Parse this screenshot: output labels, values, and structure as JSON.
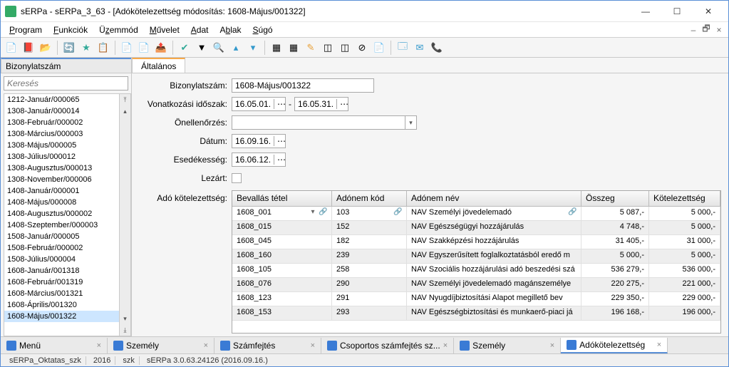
{
  "window": {
    "title": "sERPa - sERPa_3_63 - [Adókötelezettség módosítás: 1608-Május/001322]"
  },
  "menu": {
    "items": [
      "Program",
      "Funkciók",
      "Üzemmód",
      "Művelet",
      "Adat",
      "Ablak",
      "Súgó"
    ]
  },
  "leftPanel": {
    "title": "Bizonylatszám",
    "searchPlaceholder": "Keresés",
    "items": [
      "1212-Január/000065",
      "1308-Január/000014",
      "1308-Február/000002",
      "1308-Március/000003",
      "1308-Május/000005",
      "1308-Július/000012",
      "1308-Augusztus/000013",
      "1308-November/000006",
      "1408-Január/000001",
      "1408-Május/000008",
      "1408-Augusztus/000002",
      "1408-Szeptember/000003",
      "1508-Január/000005",
      "1508-Február/000002",
      "1508-Július/000004",
      "1608-Január/001318",
      "1608-Február/001319",
      "1608-Március/001321",
      "1608-Április/001320",
      "1608-Május/001322"
    ],
    "selectedIndex": 19
  },
  "tab": {
    "label": "Általános"
  },
  "form": {
    "labels": {
      "biz": "Bizonylatszám:",
      "von": "Vonatkozási időszak:",
      "one": "Önellenőrzés:",
      "dat": "Dátum:",
      "ese": "Esedékesség:",
      "lez": "Lezárt:",
      "ado": "Adó kötelezettség:"
    },
    "values": {
      "biz": "1608-Május/001322",
      "vonFrom": "16.05.01.",
      "vonTo": "16.05.31.",
      "datum": "16.09.16.",
      "esedek": "16.06.12.",
      "dash": "-"
    }
  },
  "grid": {
    "headers": [
      "Bevallás tétel",
      "Adónem kód",
      "Adónem név",
      "Összeg",
      "Kötelezettség"
    ],
    "rows": [
      {
        "t": "1608_001",
        "k": "103",
        "n": "NAV Személyi jövedelemadó",
        "o": "5 087,-",
        "kt": "5 000,-",
        "first": true
      },
      {
        "t": "1608_015",
        "k": "152",
        "n": "NAV Egészségügyi hozzájárulás",
        "o": "4 748,-",
        "kt": "5 000,-"
      },
      {
        "t": "1608_045",
        "k": "182",
        "n": "NAV Szakképzési hozzájárulás",
        "o": "31 405,-",
        "kt": "31 000,-"
      },
      {
        "t": "1608_160",
        "k": "239",
        "n": "NAV Egyszerűsített foglalkoztatásból eredő m",
        "o": "5 000,-",
        "kt": "5 000,-"
      },
      {
        "t": "1608_105",
        "k": "258",
        "n": "NAV Szociális hozzájárulási adó beszedési szá",
        "o": "536 279,-",
        "kt": "536 000,-"
      },
      {
        "t": "1608_076",
        "k": "290",
        "n": "NAV Személyi jövedelemadó magánszemélye",
        "o": "220 275,-",
        "kt": "221 000,-"
      },
      {
        "t": "1608_123",
        "k": "291",
        "n": "NAV Nyugdíjbiztosítási Alapot megillető bev",
        "o": "229 350,-",
        "kt": "229 000,-"
      },
      {
        "t": "1608_153",
        "k": "293",
        "n": "NAV Egészségbiztosítási és munkaerő-piaci já",
        "o": "196 168,-",
        "kt": "196 000,-"
      }
    ]
  },
  "tasks": [
    {
      "label": "Menü",
      "color": "#3a7bd5",
      "active": false
    },
    {
      "label": "Személy",
      "color": "#3a7bd5",
      "active": false
    },
    {
      "label": "Számfejtés",
      "color": "#3a7bd5",
      "active": false
    },
    {
      "label": "Csoportos számfejtés sz...",
      "color": "#3a7bd5",
      "active": false
    },
    {
      "label": "Személy",
      "color": "#3a7bd5",
      "active": false
    },
    {
      "label": "Adókötelezettség",
      "color": "#3a7bd5",
      "active": true
    }
  ],
  "status": {
    "s1": "sERPa_Oktatas_szk",
    "s2": "2016",
    "s3": "szk",
    "s4": "sERPa 3.0.63.24126 (2016.09.16.)"
  },
  "icons": {
    "dots": "⋯",
    "dropdown": "▾",
    "clip": "📎"
  }
}
